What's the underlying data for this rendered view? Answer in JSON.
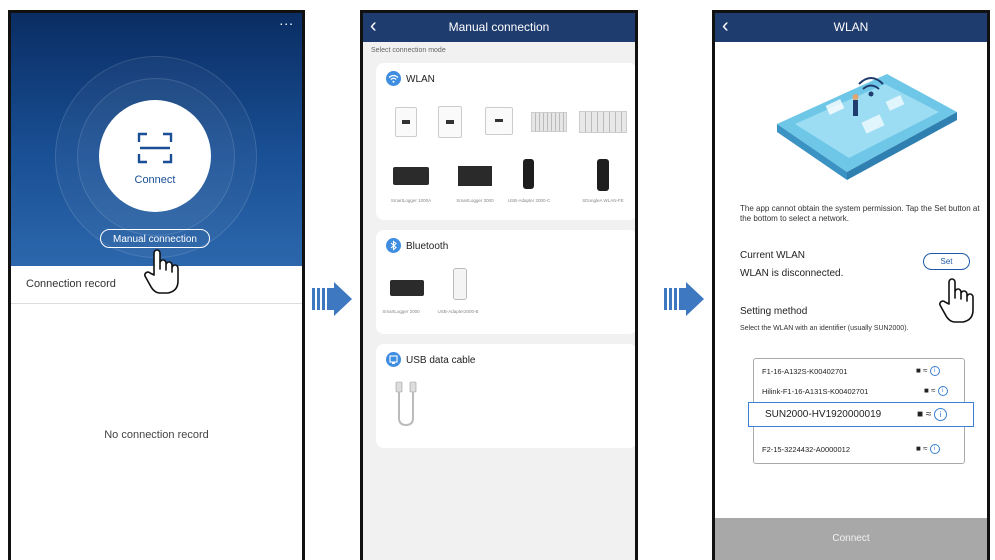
{
  "screen1": {
    "more_menu": "...",
    "connect_label": "Connect",
    "manual_connection_label": "Manual connection",
    "connection_record_label": "Connection record",
    "empty_record_text": "No connection record"
  },
  "screen2": {
    "title": "Manual connection",
    "mode_label": "Select connection mode",
    "wlan": {
      "title": "WLAN",
      "captions": [
        "SmartLogger 1000A",
        "SmartLogger 3000",
        "USB-Adapter 2000-C",
        "SDongleA WLAN-FE"
      ]
    },
    "bluetooth": {
      "title": "Bluetooth",
      "captions": [
        "SmartLogger 2000",
        "USB-Adapter2000-B"
      ]
    },
    "usb": {
      "title": "USB data cable"
    }
  },
  "screen3": {
    "title": "WLAN",
    "permission_text": "The app cannot obtain the system permission. Tap the Set button at the bottom to select a network.",
    "current_wlan_label": "Current WLAN",
    "current_wlan_status": "WLAN is disconnected.",
    "set_button": "Set",
    "setting_method_label": "Setting method",
    "setting_method_desc": "Select the WLAN with an identifier (usually SUN2000).",
    "networks": [
      "F1-16-A132S-K00402701",
      "Hilink-F1-16-A131S-K00402701",
      "SUN2000-HV1920000019",
      "F2-15-3224432-A0000012"
    ],
    "connect_button": "Connect"
  },
  "colors": {
    "header_blue": "#1f3c6e",
    "hero_blue": "#194f94",
    "accent_blue": "#3a7fd0",
    "arrow_blue": "#3d78c0"
  }
}
